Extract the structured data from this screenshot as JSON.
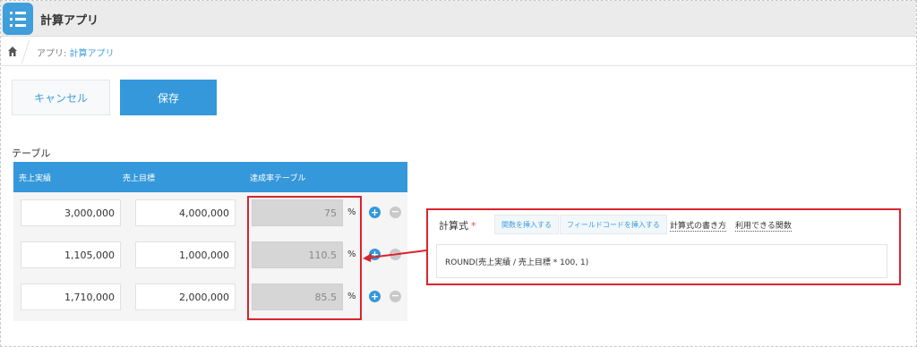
{
  "header": {
    "app_title": "計算アプリ"
  },
  "breadcrumb": {
    "prefix": "アプリ: ",
    "app_link": "計算アプリ"
  },
  "toolbar": {
    "cancel_label": "キャンセル",
    "save_label": "保存"
  },
  "table": {
    "label": "テーブル",
    "columns": [
      "売上実績",
      "売上目標",
      "達成率テーブル"
    ],
    "rows": [
      {
        "actual": "3,000,000",
        "target": "4,000,000",
        "rate": "75",
        "unit": "%"
      },
      {
        "actual": "1,105,000",
        "target": "1,000,000",
        "rate": "110.5",
        "unit": "%"
      },
      {
        "actual": "1,710,000",
        "target": "2,000,000",
        "rate": "85.5",
        "unit": "%"
      }
    ],
    "add_glyph": "+",
    "remove_glyph": "−"
  },
  "formula_panel": {
    "label": "計算式",
    "required_mark": "*",
    "insert_function_label": "関数を挿入する",
    "insert_field_code_label": "フィールドコードを挿入する",
    "how_to_write_label": "計算式の書き方",
    "available_functions_label": "利用できる関数",
    "formula_value": "ROUND(売上実績 / 売上目標 * 100, 1)"
  },
  "colors": {
    "accent": "#3498db",
    "highlight": "#d9242d",
    "header_bg": "#ebebeb"
  },
  "icons": {
    "app": "list-app-icon",
    "home": "home-icon"
  }
}
